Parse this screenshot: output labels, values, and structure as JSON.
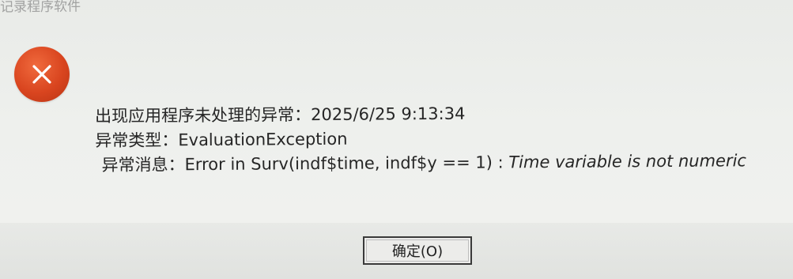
{
  "window": {
    "title_fragment": "记录程序软件"
  },
  "error": {
    "icon": "error-x-icon",
    "icon_color": "#d9451f"
  },
  "message": {
    "line1": "出现应用程序未处理的异常：2025/6/25 9:13:34",
    "line2": "异常类型：EvaluationException",
    "line3_prefix": "异常消息：Error in Surv(indf$time, indf$y == 1) : ",
    "line3_italic": "Time variable is not numeric"
  },
  "buttons": {
    "ok_label": "确定(O)"
  }
}
